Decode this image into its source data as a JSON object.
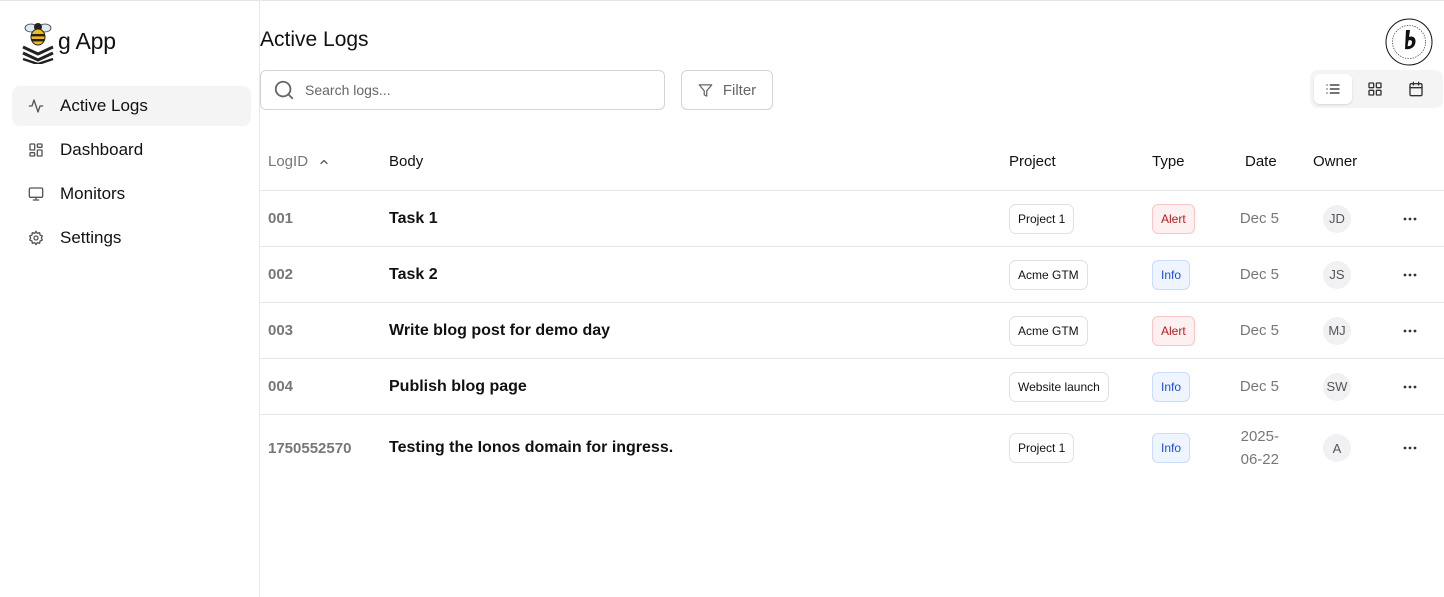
{
  "app": {
    "name": "g App"
  },
  "sidebar": {
    "items": [
      {
        "label": "Active Logs",
        "icon": "activity-icon",
        "active": true
      },
      {
        "label": "Dashboard",
        "icon": "dashboard-icon",
        "active": false
      },
      {
        "label": "Monitors",
        "icon": "monitor-icon",
        "active": false
      },
      {
        "label": "Settings",
        "icon": "gear-icon",
        "active": false
      }
    ]
  },
  "main": {
    "title": "Active Logs",
    "search": {
      "placeholder": "Search logs...",
      "value": ""
    },
    "filter_label": "Filter",
    "view_modes": [
      "list-view-icon",
      "grid-view-icon",
      "calendar-view-icon"
    ],
    "active_view": "list-view-icon"
  },
  "table": {
    "columns": {
      "logid": "LogID",
      "body": "Body",
      "project": "Project",
      "type": "Type",
      "date": "Date",
      "owner": "Owner"
    },
    "sort": {
      "column": "LogID",
      "direction": "ascending"
    },
    "rows": [
      {
        "id": "001",
        "body": "Task 1",
        "project": "Project 1",
        "type": "Alert",
        "date": "Dec 5",
        "owner": "JD"
      },
      {
        "id": "002",
        "body": "Task 2",
        "project": "Acme GTM",
        "type": "Info",
        "date": "Dec 5",
        "owner": "JS"
      },
      {
        "id": "003",
        "body": "Write blog post for demo day",
        "project": "Acme GTM",
        "type": "Alert",
        "date": "Dec 5",
        "owner": "MJ"
      },
      {
        "id": "004",
        "body": "Publish blog page",
        "project": "Website launch",
        "type": "Info",
        "date": "Dec 5",
        "owner": "SW"
      },
      {
        "id": "1750552570",
        "body": "Testing the Ionos domain for ingress.",
        "project": "Project 1",
        "type": "Info",
        "date": "2025-06-22",
        "owner": "A"
      }
    ]
  },
  "colors": {
    "alert_text": "#b91c1c",
    "alert_bg": "#fdf0f0",
    "info_text": "#1d4ed8",
    "info_bg": "#eef5ff",
    "active_nav_bg": "#f4f4f5"
  }
}
